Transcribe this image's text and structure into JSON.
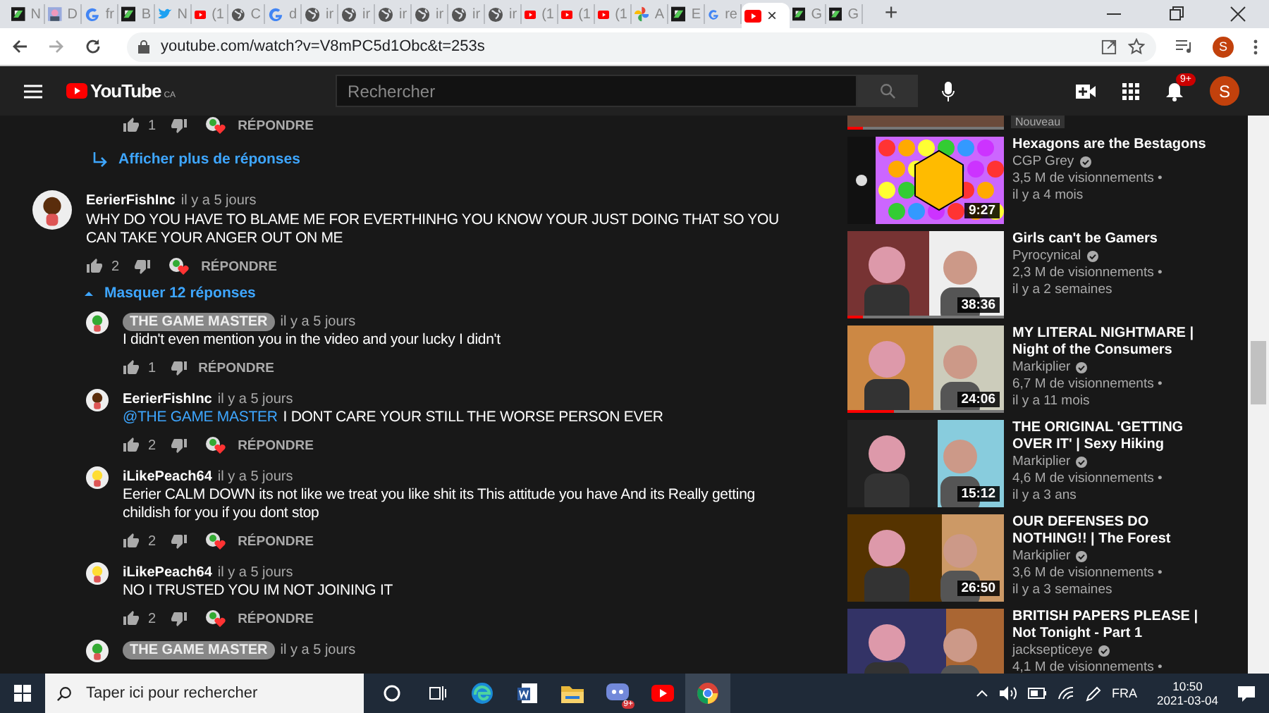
{
  "browser": {
    "tabs": [
      {
        "kind": "green",
        "label": "N",
        "selected": false
      },
      {
        "label": "D",
        "selected": false
      },
      {
        "kind": "google",
        "label": "fr",
        "selected": false
      },
      {
        "kind": "green",
        "label": "B",
        "selected": false
      },
      {
        "kind": "bird",
        "label": "N",
        "selected": false
      },
      {
        "kind": "youtube",
        "label": "(1",
        "selected": false
      },
      {
        "kind": "globe",
        "label": "C",
        "selected": false
      },
      {
        "kind": "google",
        "label": "d",
        "selected": false
      },
      {
        "kind": "globe",
        "label": "ir",
        "selected": false
      },
      {
        "kind": "globe",
        "label": "ir",
        "selected": false
      },
      {
        "kind": "globe",
        "label": "ir",
        "selected": false
      },
      {
        "kind": "globe",
        "label": "ir",
        "selected": false
      },
      {
        "kind": "globe",
        "label": "ir",
        "selected": false
      },
      {
        "kind": "globe",
        "label": "ir",
        "selected": false
      },
      {
        "kind": "youtube",
        "label": "(1",
        "selected": false
      },
      {
        "kind": "youtube",
        "label": "(1",
        "selected": false
      },
      {
        "kind": "youtube",
        "label": "(1",
        "selected": false
      },
      {
        "kind": "pinwheel",
        "label": "A",
        "selected": false
      },
      {
        "kind": "green",
        "label": "E",
        "selected": false
      },
      {
        "kind": "google",
        "label": "re",
        "selected": false
      },
      {
        "kind": "youtube",
        "label": "×",
        "selected": true
      },
      {
        "kind": "green",
        "label": "G",
        "selected": false
      },
      {
        "kind": "green",
        "label": "G",
        "selected": false
      }
    ],
    "new_tab": "+",
    "address": "youtube.com/watch?v=V8mPC5d1Obc&t=253s",
    "profile": "S"
  },
  "header": {
    "logo": "YouTube",
    "region": "CA",
    "search": {
      "placeholder": "Rechercher"
    },
    "notifications": "9+",
    "avatar": "S"
  },
  "comments": {
    "tail_actions": {
      "likes": "1",
      "hearted": true,
      "reply": "RÉPONDRE"
    },
    "more_replies": "Afficher plus de réponses",
    "thread": {
      "author": "EerierFishInc",
      "kind": "user",
      "color": "#5a2d0c",
      "time": "il y a 5 jours",
      "text": "WHY DO YOU HAVE TO BLAME ME FOR EVERTHINHG YOU KNOW YOUR JUST DOING THAT SO YOU CAN TAKE YOUR ANGER OUT ON ME",
      "likes": "2",
      "hearted": true,
      "reply": "RÉPONDRE"
    },
    "hide_replies": "Masquer 12 réponses",
    "replies": [
      {
        "author": "THE GAME MASTER",
        "kind": "creator",
        "color": "#33aa33",
        "time": "il y a 5 jours",
        "text": "I didn't even mention you in the video and your lucky I didn't",
        "likes": "1",
        "hearted": false,
        "reply": "RÉPONDRE"
      },
      {
        "author": "EerierFishInc",
        "kind": "user",
        "color": "#5a2d0c",
        "time": "il y a 5 jours",
        "mention": "@THE GAME MASTER",
        "text": "I DONT CARE YOUR STILL THE WORSE PERSON EVER",
        "likes": "2",
        "hearted": true,
        "reply": "RÉPONDRE"
      },
      {
        "author": "iLikePeach64",
        "kind": "user",
        "color": "#ffdd33",
        "time": "il y a 5 jours",
        "text": "Eerier CALM DOWN its not like we treat you like shit its This attitude you have And its Really getting childish for you if you dont stop",
        "likes": "2",
        "hearted": true,
        "reply": "RÉPONDRE"
      },
      {
        "author": "iLikePeach64",
        "kind": "user",
        "color": "#ffdd33",
        "time": "il y a 5 jours",
        "text": "NO I TRUSTED YOU IM NOT JOINING IT",
        "likes": "2",
        "hearted": true,
        "reply": "RÉPONDRE"
      },
      {
        "author": "THE GAME MASTER",
        "kind": "creator",
        "color": "#33aa33",
        "time": "il y a 5 jours"
      }
    ]
  },
  "sidebar": {
    "partial": {
      "badge": "Nouveau",
      "level": 0.1
    },
    "videos": [
      {
        "title": "Hexagons are the Bestagons",
        "channel": "CGP Grey",
        "verified": true,
        "views": "3,5 M de visionnements •",
        "age": "il y a 4 mois",
        "duration": "9:27"
      },
      {
        "title": "Girls can't be Gamers",
        "channel": "Pyrocynical",
        "verified": true,
        "views": "2,3 M de visionnements •",
        "age": "il y a 2 semaines",
        "duration": "38:36",
        "level": 0.1
      },
      {
        "title": "MY LITERAL NIGHTMARE | Night of the Consumers",
        "channel": "Markiplier",
        "verified": true,
        "views": "6,7 M de visionnements •",
        "age": "il y a 11 mois",
        "duration": "24:06",
        "level": 0.3
      },
      {
        "title": "THE ORIGINAL 'GETTING OVER IT' | Sexy Hiking",
        "channel": "Markiplier",
        "verified": true,
        "views": "4,6 M de visionnements •",
        "age": "il y a 3 ans",
        "duration": "15:12"
      },
      {
        "title": "OUR DEFENSES DO NOTHING!! | The Forest",
        "channel": "Markiplier",
        "verified": true,
        "views": "3,6 M de visionnements •",
        "age": "il y a 3 semaines",
        "duration": "26:50"
      },
      {
        "title": "BRITISH PAPERS PLEASE | Not Tonight - Part 1",
        "channel": "jacksepticeye",
        "verified": true,
        "views": "4,1 M de visionnements •"
      }
    ]
  },
  "taskbar": {
    "search": {
      "placeholder": "Taper ici pour rechercher"
    },
    "discord_badge": "9+",
    "language": "FRA",
    "time": "10:50",
    "date": "2021-03-04"
  }
}
